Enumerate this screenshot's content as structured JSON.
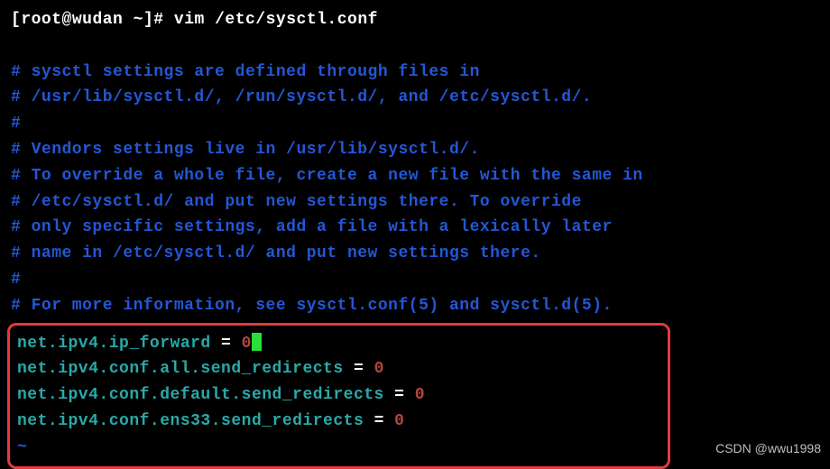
{
  "prompt": {
    "open_bracket": "[",
    "user": "root",
    "at": "@",
    "host": "wudan",
    "space_path": " ~",
    "close_bracket": "]",
    "char": "# ",
    "command": "vim /etc/sysctl.conf"
  },
  "comments": [
    "# sysctl settings are defined through files in",
    "# /usr/lib/sysctl.d/, /run/sysctl.d/, and /etc/sysctl.d/.",
    "#",
    "# Vendors settings live in /usr/lib/sysctl.d/.",
    "# To override a whole file, create a new file with the same in",
    "# /etc/sysctl.d/ and put new settings there. To override",
    "# only specific settings, add a file with a lexically later",
    "# name in /etc/sysctl.d/ and put new settings there.",
    "#",
    "# For more information, see sysctl.conf(5) and sysctl.d(5)."
  ],
  "settings": [
    {
      "key": "net.ipv4.ip_forward",
      "eq": " = ",
      "val": "0",
      "cursor": true
    },
    {
      "key": "net.ipv4.conf.all.send_redirects",
      "eq": " = ",
      "val": "0",
      "cursor": false
    },
    {
      "key": "net.ipv4.conf.default.send_redirects",
      "eq": " = ",
      "val": "0",
      "cursor": false
    },
    {
      "key": "net.ipv4.conf.ens33.send_redirects",
      "eq": " = ",
      "val": "0",
      "cursor": false
    }
  ],
  "tilde_line": "~",
  "watermark": "CSDN @wwu1998"
}
